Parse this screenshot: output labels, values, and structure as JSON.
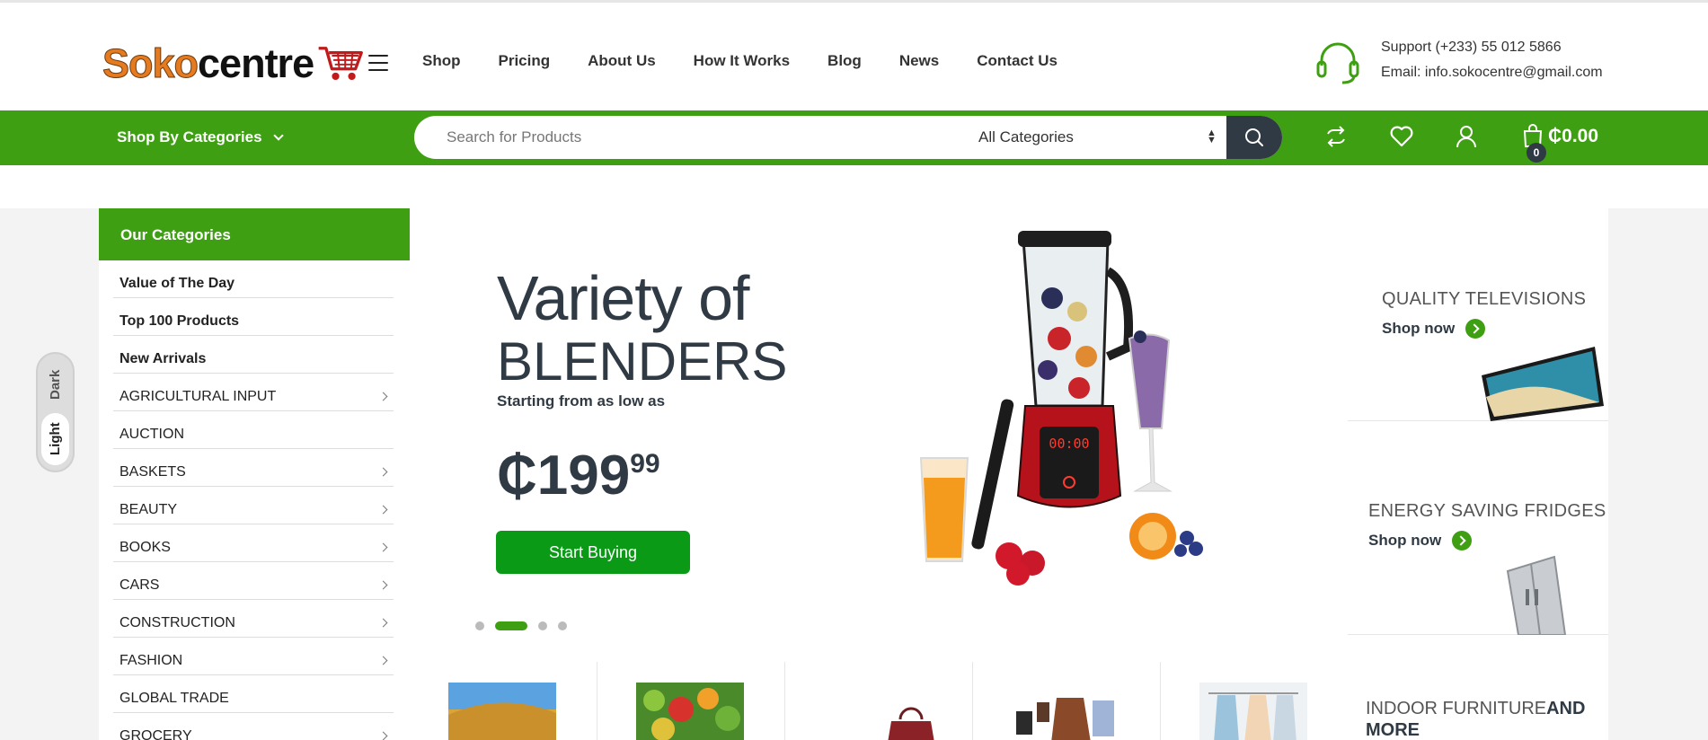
{
  "header": {
    "logo": {
      "word1": "Soko",
      "word2": "centre"
    },
    "nav": [
      "Shop",
      "Pricing",
      "About Us",
      "How It Works",
      "Blog",
      "News",
      "Contact Us"
    ],
    "support": {
      "phone": "Support (+233) 55 012 5866",
      "email": "Email: info.sokocentre@gmail.com"
    }
  },
  "bar": {
    "categories_label": "Shop By Categories",
    "search_placeholder": "Search for Products",
    "category_select": "All Categories",
    "cart_total": "₵0.00",
    "cart_count": "0"
  },
  "sidebar": {
    "title": "Our Categories",
    "items": [
      {
        "label": "Value of The Day"
      },
      {
        "label": "Top 100 Products"
      },
      {
        "label": "New Arrivals"
      },
      {
        "label": "AGRICULTURAL INPUT"
      },
      {
        "label": "AUCTION"
      },
      {
        "label": "BASKETS"
      },
      {
        "label": "BEAUTY"
      },
      {
        "label": "BOOKS"
      },
      {
        "label": "CARS"
      },
      {
        "label": "CONSTRUCTION"
      },
      {
        "label": "FASHION"
      },
      {
        "label": "GLOBAL TRADE"
      },
      {
        "label": "GROCERY"
      }
    ]
  },
  "theme_toggle": {
    "dark": "Dark",
    "light": "Light"
  },
  "hero": {
    "line1": "Variety of",
    "line2": "BLENDERS",
    "subtitle": "Starting from as low as",
    "price_main": "₵199",
    "price_cents": "99",
    "button": "Start Buying",
    "blender_display": "00:00"
  },
  "promos": [
    {
      "title": "QUALITY TELEVISIONS",
      "link": "Shop now"
    },
    {
      "title": "ENERGY SAVING FRIDGES",
      "link": "Shop now"
    },
    {
      "title_a": "INDOOR FURNITURE",
      "title_b": "AND",
      "title_c": "MORE"
    }
  ],
  "colors": {
    "brand_green": "#3f9f12",
    "button_green": "#0a9a15",
    "dark": "#2f3a44"
  }
}
